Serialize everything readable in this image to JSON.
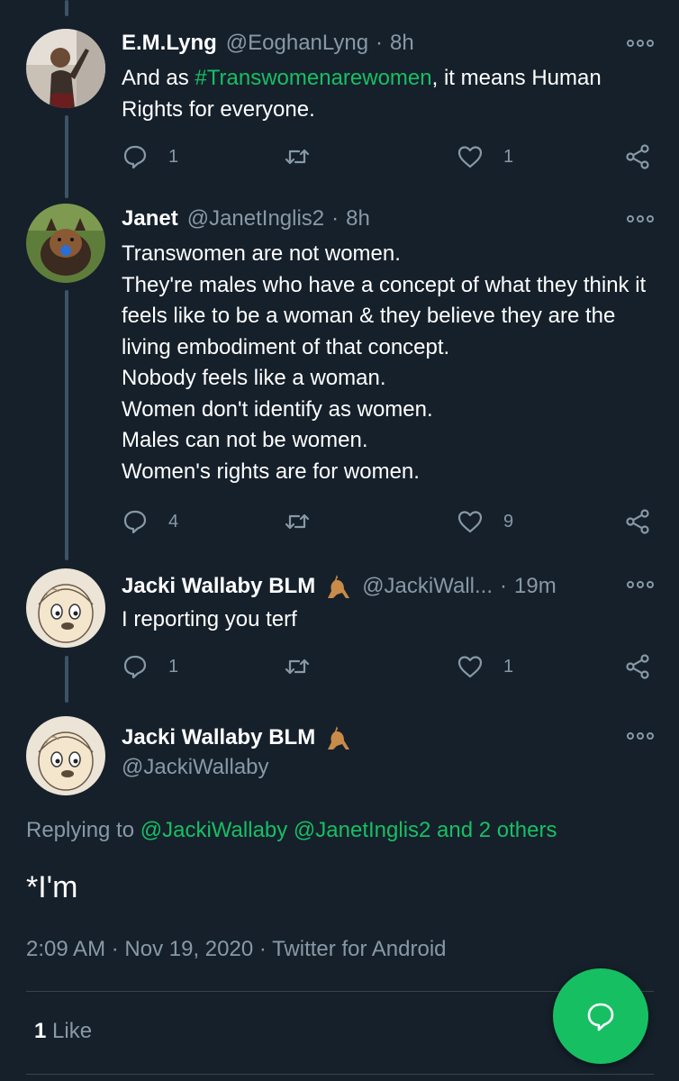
{
  "tweets": [
    {
      "name": "E.M.Lyng",
      "handle": "@EoghanLyng",
      "time": "8h",
      "text_parts": [
        "And as ",
        "#Transwomenarewomen",
        ", it means Human Rights for everyone."
      ],
      "replies": "1",
      "retweets": "",
      "likes": "1"
    },
    {
      "name": "Janet",
      "handle": "@JanetInglis2",
      "time": "8h",
      "lines": [
        "Transwomen are not women.",
        "They're males who have a concept of what they think it feels like to be a woman & they believe they are the living embodiment of that concept.",
        "Nobody feels like a woman.",
        "Women don't identify as women.",
        "Males can not be women.",
        "Women's rights are for women."
      ],
      "replies": "4",
      "retweets": "",
      "likes": "9"
    },
    {
      "name": "Jacki Wallaby BLM",
      "handle": "@JackiWall...",
      "time": "19m",
      "text": "I reporting you terf",
      "replies": "1",
      "retweets": "",
      "likes": "1",
      "emoji": "kangaroo-emoji"
    }
  ],
  "main": {
    "name": "Jacki Wallaby BLM",
    "handle": "@JackiWallaby",
    "replying_prefix": "Replying to ",
    "replying_users": "@JackiWallaby @JanetInglis2 and 2 others",
    "text": "*I'm",
    "timestamp": "2:09 AM",
    "date": "Nov 19, 2020",
    "source": "Twitter for Android",
    "likes_count": "1",
    "likes_label": "Like"
  },
  "icons": {
    "reply": "reply-icon",
    "retweet": "retweet-icon",
    "like": "heart-icon",
    "share": "share-icon",
    "more": "more-icon",
    "compose": "compose-reply-icon"
  },
  "colors": {
    "background": "#15202b",
    "accent": "#17bf63",
    "muted": "#8899a6"
  }
}
